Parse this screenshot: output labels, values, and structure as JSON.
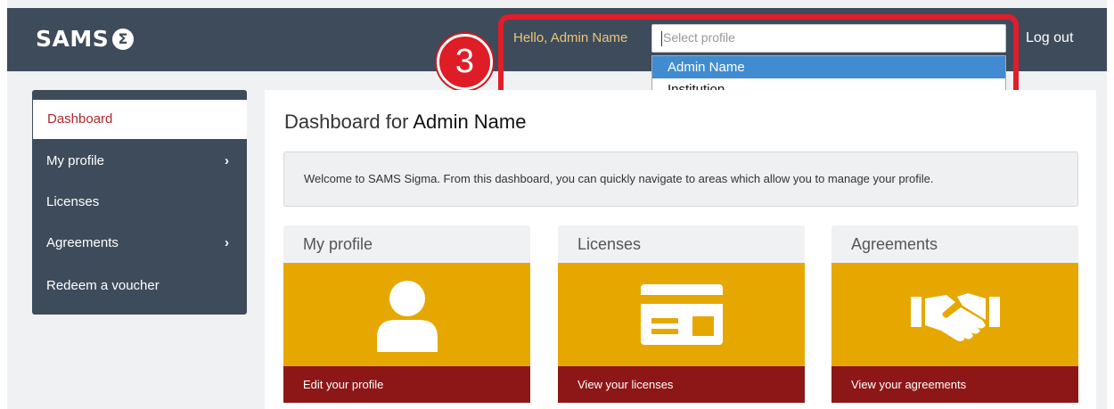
{
  "header": {
    "logo_text": "SAMS",
    "logo_symbol": "Σ",
    "greeting": "Hello, Admin Name",
    "profile_select": {
      "placeholder": "Select profile",
      "options": [
        "Admin Name",
        "Institution"
      ],
      "highlighted": "Admin Name"
    },
    "logout_label": "Log out",
    "step_badge": "3"
  },
  "sidebar": {
    "items": [
      {
        "label": "Dashboard",
        "active": true,
        "has_chevron": false
      },
      {
        "label": "My profile",
        "active": false,
        "has_chevron": true
      },
      {
        "label": "Licenses",
        "active": false,
        "has_chevron": false
      },
      {
        "label": "Agreements",
        "active": false,
        "has_chevron": true
      },
      {
        "label": "Redeem a voucher",
        "active": false,
        "has_chevron": false
      }
    ],
    "chevron": "›"
  },
  "main": {
    "title_prefix": "Dashboard for",
    "title_name": "Admin Name",
    "welcome": "Welcome to SAMS Sigma. From this dashboard, you can quickly navigate to areas which allow you to manage your profile.",
    "cards": [
      {
        "title": "My profile",
        "icon": "user-icon",
        "link": "Edit your profile"
      },
      {
        "title": "Licenses",
        "icon": "license-card-icon",
        "link": "View your licenses"
      },
      {
        "title": "Agreements",
        "icon": "handshake-icon",
        "link": "View your agreements"
      }
    ]
  },
  "colors": {
    "header_bg": "#3e4b5b",
    "accent_gold": "#e6a800",
    "card_footer": "#8c1716",
    "active_red": "#b5262b",
    "highlight_red": "#e11d2a",
    "dropdown_highlight": "#418cd0",
    "greeting_text": "#e8c77a"
  }
}
